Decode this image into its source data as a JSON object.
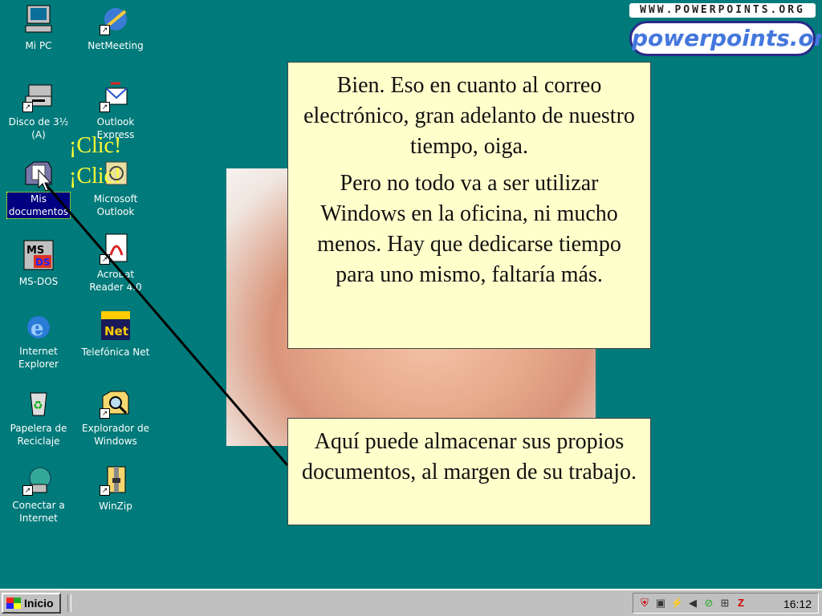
{
  "desktop": {
    "icons_col1": [
      {
        "label": "Mi PC"
      },
      {
        "label": "Disco de 3½\n(A)"
      },
      {
        "label": "Mis\ndocumentos"
      },
      {
        "label": "MS-DOS"
      },
      {
        "label": "Internet\nExplorer"
      },
      {
        "label": "Papelera de\nReciclaje"
      },
      {
        "label": "Conectar a\nInternet"
      }
    ],
    "icons_col2": [
      {
        "label": "NetMeeting"
      },
      {
        "label": "Outlook\nExpress"
      },
      {
        "label": "Microsoft\nOutlook"
      },
      {
        "label": "Acrobat\nReader 4.0"
      },
      {
        "label": "Telefónica Net"
      },
      {
        "label": "Explorador de\nWindows"
      },
      {
        "label": "WinZip"
      }
    ],
    "clic_1": "¡Clic!",
    "clic_2": "¡Clic!"
  },
  "logo": {
    "top_text": "WWW.POWERPOINTS.ORG",
    "main_text": "powerpoints.org"
  },
  "callout_top": {
    "paragraph_1": "Bien. Eso en cuanto al correo electrónico, gran adelanto de nuestro tiempo, oiga.",
    "paragraph_2": "Pero no todo va a ser utilizar Windows en la oficina, ni mucho menos. Hay que dedicarse tiempo para uno mismo, faltaría más."
  },
  "callout_bottom": {
    "text": "Aquí puede almacenar sus propios documentos, al margen de su trabajo."
  },
  "taskbar": {
    "start_label": "Inicio",
    "clock": "16:12"
  },
  "colors": {
    "desktop": "#007a7a",
    "callout": "#ffffcc",
    "taskbar": "#c0c0c0",
    "selection": "#000080"
  }
}
